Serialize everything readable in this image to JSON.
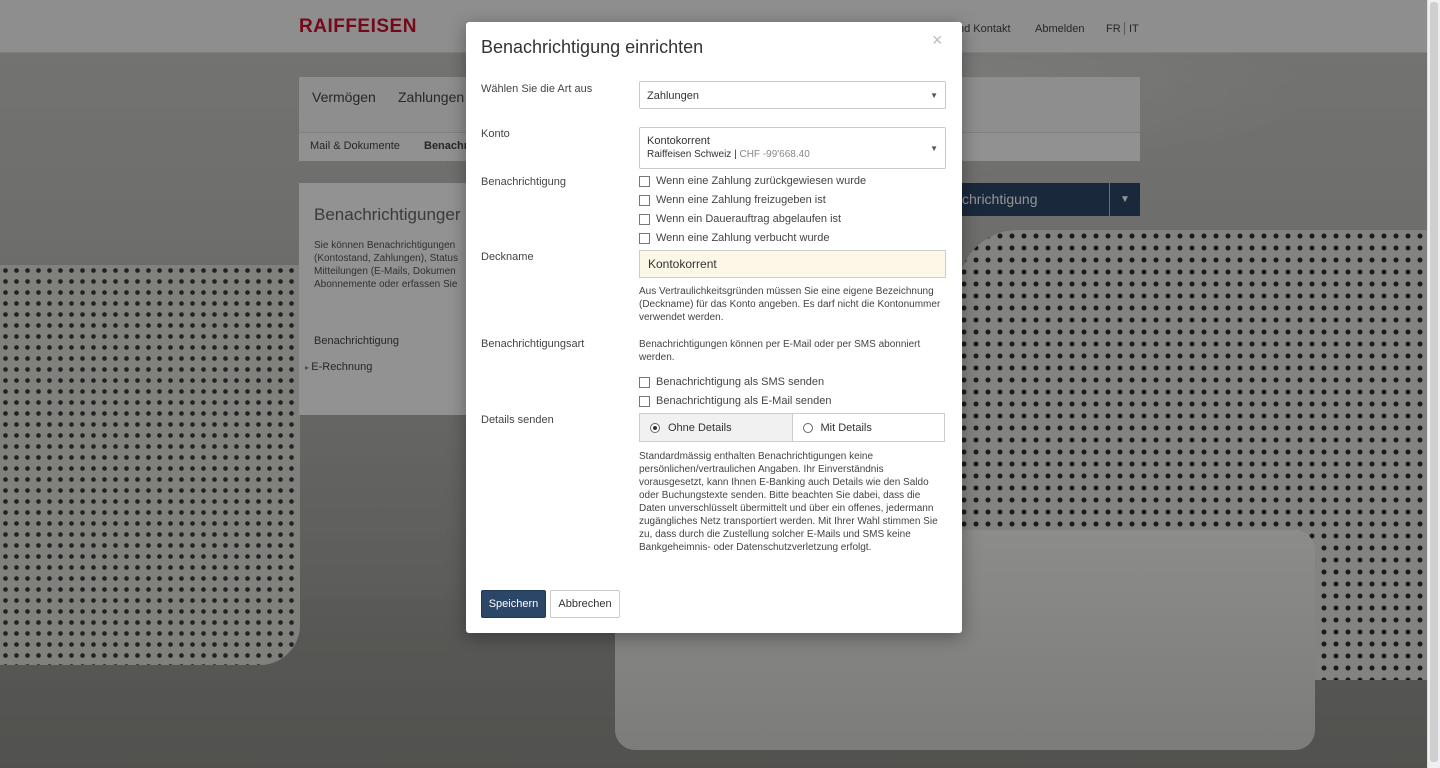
{
  "header": {
    "logo": "RAIFFEISEN",
    "links": [
      "nd Kontakt",
      "Abmelden"
    ],
    "languages": [
      "FR",
      "IT"
    ]
  },
  "nav": {
    "items": [
      "Vermögen",
      "Zahlungen"
    ]
  },
  "subnav": {
    "items": [
      "Mail & Dokumente",
      "Benachri"
    ]
  },
  "content": {
    "title": "Benachrichtigunger",
    "text": [
      "Sie können Benachrichtigungen",
      "(Kontostand, Zahlungen), Status",
      "Mitteilungen (E-Mails, Dokumen",
      "Abonnemente oder erfassen Sie"
    ],
    "link1": "Benachrichtigung",
    "link2": "E-Rechnung"
  },
  "header_button": {
    "label": "chrichtigung"
  },
  "modal": {
    "title": "Benachrichtigung einrichten",
    "close": "×",
    "type_label": "Wählen Sie die Art aus",
    "type_value": "Zahlungen",
    "konto_label": "Konto",
    "konto_name": "Kontokorrent",
    "konto_bank": "Raiffeisen Schweiz",
    "konto_sep": "|",
    "konto_balance": "CHF -99'668.40",
    "notif_label": "Benachrichtigung",
    "notif_options": [
      "Wenn eine Zahlung zurückgewiesen wurde",
      "Wenn eine Zahlung freizugeben ist",
      "Wenn ein Dauerauftrag abgelaufen ist",
      "Wenn eine Zahlung verbucht wurde"
    ],
    "deckname_label": "Deckname",
    "deckname_value": "Kontokorrent",
    "deckname_help": "Aus Vertraulichkeitsgründen müssen Sie eine eigene Bezeichnung (Deckname) für das Konto angeben. Es darf nicht die Kontonummer verwendet werden.",
    "art_label": "Benachrichtigungsart",
    "art_help": "Benachrichtigungen können per E-Mail oder per SMS abonniert werden.",
    "art_options": [
      "Benachrichtigung als SMS senden",
      "Benachrichtigung als E-Mail senden"
    ],
    "details_label": "Details senden",
    "details_options": [
      "Ohne Details",
      "Mit Details"
    ],
    "details_selected": "Ohne Details",
    "details_help": "Standardmässig enthalten Benachrichtigungen keine persönlichen/vertraulichen Angaben. Ihr Einverständnis vorausgesetzt, kann Ihnen E-Banking auch Details wie den Saldo oder Buchungstexte senden. Bitte beachten Sie dabei, dass die Daten unverschlüsselt übermittelt und über ein offenes, jedermann zugängliches Netz transportiert werden. Mit Ihrer Wahl stimmen Sie zu, dass durch die Zustellung solcher E-Mails und SMS keine Bankgeheimnis- oder Datenschutzverletzung erfolgt.",
    "save": "Speichern",
    "cancel": "Abbrechen"
  },
  "colors": {
    "brand": "#c8102e",
    "primary_button": "#2b4667",
    "input_highlight": "#fcf7e6"
  }
}
